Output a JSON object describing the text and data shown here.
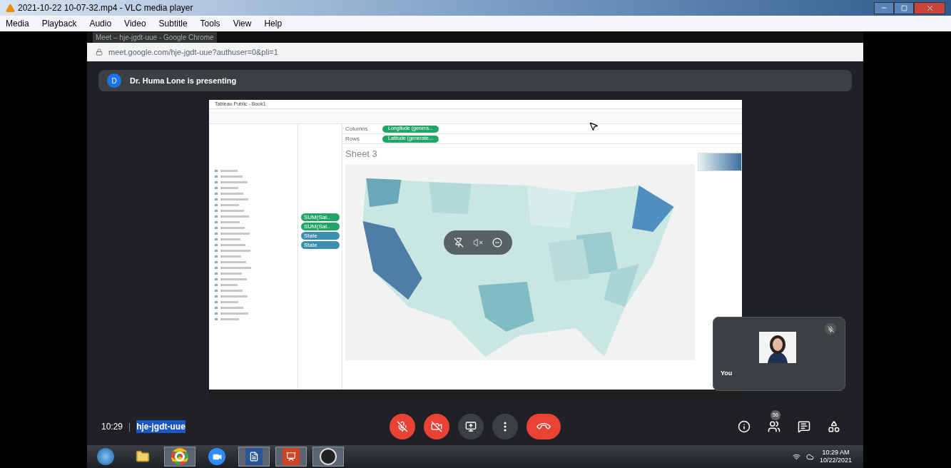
{
  "vlc": {
    "title": "2021-10-22 10-07-32.mp4 - VLC media player",
    "menu": [
      "Media",
      "Playback",
      "Audio",
      "Video",
      "Subtitle",
      "Tools",
      "View",
      "Help"
    ]
  },
  "browser": {
    "tab_title": "Meet – hje-jgdt-uue - Google Chrome",
    "url": "meet.google.com/hje-jgdt-uue?authuser=0&pli=1"
  },
  "presenting_banner": {
    "avatar": "D",
    "text": "Dr. Huma Lone is presenting"
  },
  "shared_screen": {
    "title": "Tableau Public - Book1",
    "shelves": [
      {
        "label": "Columns",
        "pill": "Longitude (genera..."
      },
      {
        "label": "Rows",
        "pill": "Latitude (generate..."
      }
    ],
    "sheet_title": "Sheet 3",
    "marks": [
      {
        "label": "SUM(Sal..",
        "color": "#22a568"
      },
      {
        "label": "SUM(Sal..",
        "color": "#22a568"
      },
      {
        "label": "State",
        "color": "#3d8fae"
      },
      {
        "label": "State",
        "color": "#3d8fae"
      }
    ]
  },
  "self_tile": {
    "name": "You",
    "muted": true
  },
  "meeting_bar": {
    "time": "10:29",
    "separator": "|",
    "code": "hje-jgdt-uue",
    "controls": [
      {
        "kind": "mic",
        "on": false
      },
      {
        "kind": "camera",
        "on": false
      },
      {
        "kind": "present"
      },
      {
        "kind": "more"
      },
      {
        "kind": "leave"
      }
    ],
    "participant_count": "56"
  },
  "taskbar": {
    "apps": [
      {
        "kind": "start",
        "running": false
      },
      {
        "kind": "folder",
        "running": false
      },
      {
        "kind": "chrome",
        "running": true
      },
      {
        "kind": "zoom",
        "running": false
      },
      {
        "kind": "word",
        "running": true
      },
      {
        "kind": "powerpoint",
        "running": true
      },
      {
        "kind": "obs",
        "running": true
      }
    ],
    "time": "10:29 AM",
    "date": "10/22/2021"
  }
}
